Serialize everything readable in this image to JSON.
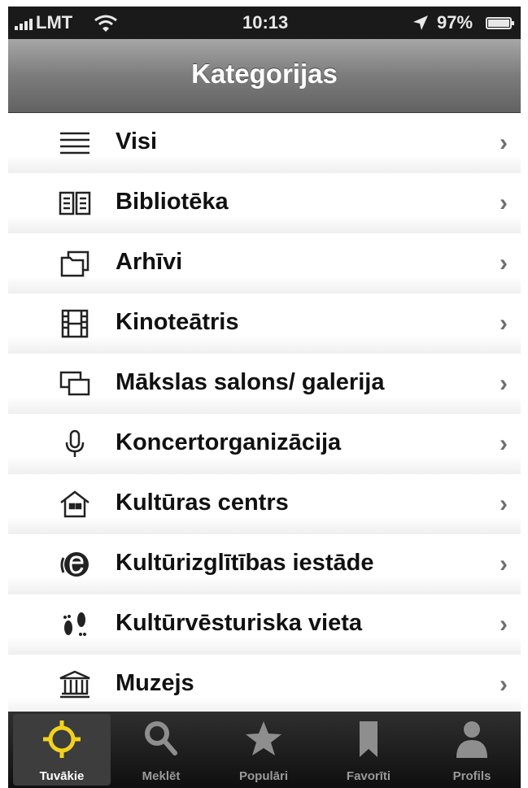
{
  "statusbar": {
    "carrier": "LMT",
    "time": "10:13",
    "battery": "97%"
  },
  "navbar": {
    "title": "Kategorijas"
  },
  "categories": [
    {
      "label": "Visi",
      "icon": "list-icon"
    },
    {
      "label": "Bibliotēka",
      "icon": "book-icon"
    },
    {
      "label": "Arhīvi",
      "icon": "folder-icon"
    },
    {
      "label": "Kinoteātris",
      "icon": "film-icon"
    },
    {
      "label": "Mākslas salons/ galerija",
      "icon": "gallery-icon"
    },
    {
      "label": "Koncertorganizācija",
      "icon": "microphone-icon"
    },
    {
      "label": "Kultūras centrs",
      "icon": "house-icon"
    },
    {
      "label": "Kultūrizglītības iestāde",
      "icon": "education-icon"
    },
    {
      "label": "Kultūrvēsturiska vieta",
      "icon": "footprints-icon"
    },
    {
      "label": "Muzejs",
      "icon": "museum-icon"
    }
  ],
  "chevron": "›",
  "tabbar": {
    "tabs": [
      {
        "label": "Tuvākie",
        "icon": "crosshair-icon",
        "active": true
      },
      {
        "label": "Meklēt",
        "icon": "search-icon",
        "active": false
      },
      {
        "label": "Populāri",
        "icon": "star-icon",
        "active": false
      },
      {
        "label": "Favorīti",
        "icon": "bookmark-icon",
        "active": false
      },
      {
        "label": "Profils",
        "icon": "person-icon",
        "active": false
      }
    ]
  },
  "colors": {
    "accent": "#f2d21c",
    "navbar": "#8a8a8a",
    "tabbar": "#1a1a1a"
  }
}
